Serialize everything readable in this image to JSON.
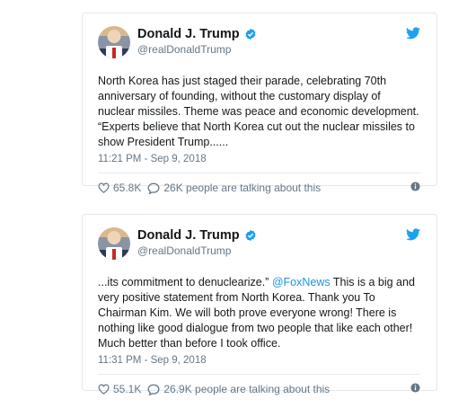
{
  "tweets": [
    {
      "name": "Donald J. Trump",
      "handle": "@realDonaldTrump",
      "text_before": "North Korea has just staged their parade, celebrating 70th anniversary of founding, without the customary display of nuclear missiles. Theme was peace and economic development. “Experts believe that North Korea cut out the nuclear missiles to show President Trump......",
      "mention": "",
      "text_after": "",
      "timestamp": "11:21 PM - Sep 9, 2018",
      "likes": "65.8K",
      "talking": "26K people are talking about this"
    },
    {
      "name": "Donald J. Trump",
      "handle": "@realDonaldTrump",
      "text_before": "...its commitment to denuclearize.” ",
      "mention": "@FoxNews",
      "text_after": "  This is a big and very positive statement from North Korea. Thank you To Chairman Kim. We will both prove everyone wrong! There is nothing like good dialogue from two people that like each other! Much better than before I took office.",
      "timestamp": "11:31 PM - Sep 9, 2018",
      "likes": "55.1K",
      "talking": "26.9K people are talking about this"
    }
  ],
  "colors": {
    "link": "#1b95e0",
    "muted": "#657786",
    "border": "#e1e8ed"
  },
  "icons": [
    "verified-badge-icon",
    "twitter-bird-icon",
    "heart-icon",
    "comment-bubble-icon",
    "info-icon"
  ]
}
